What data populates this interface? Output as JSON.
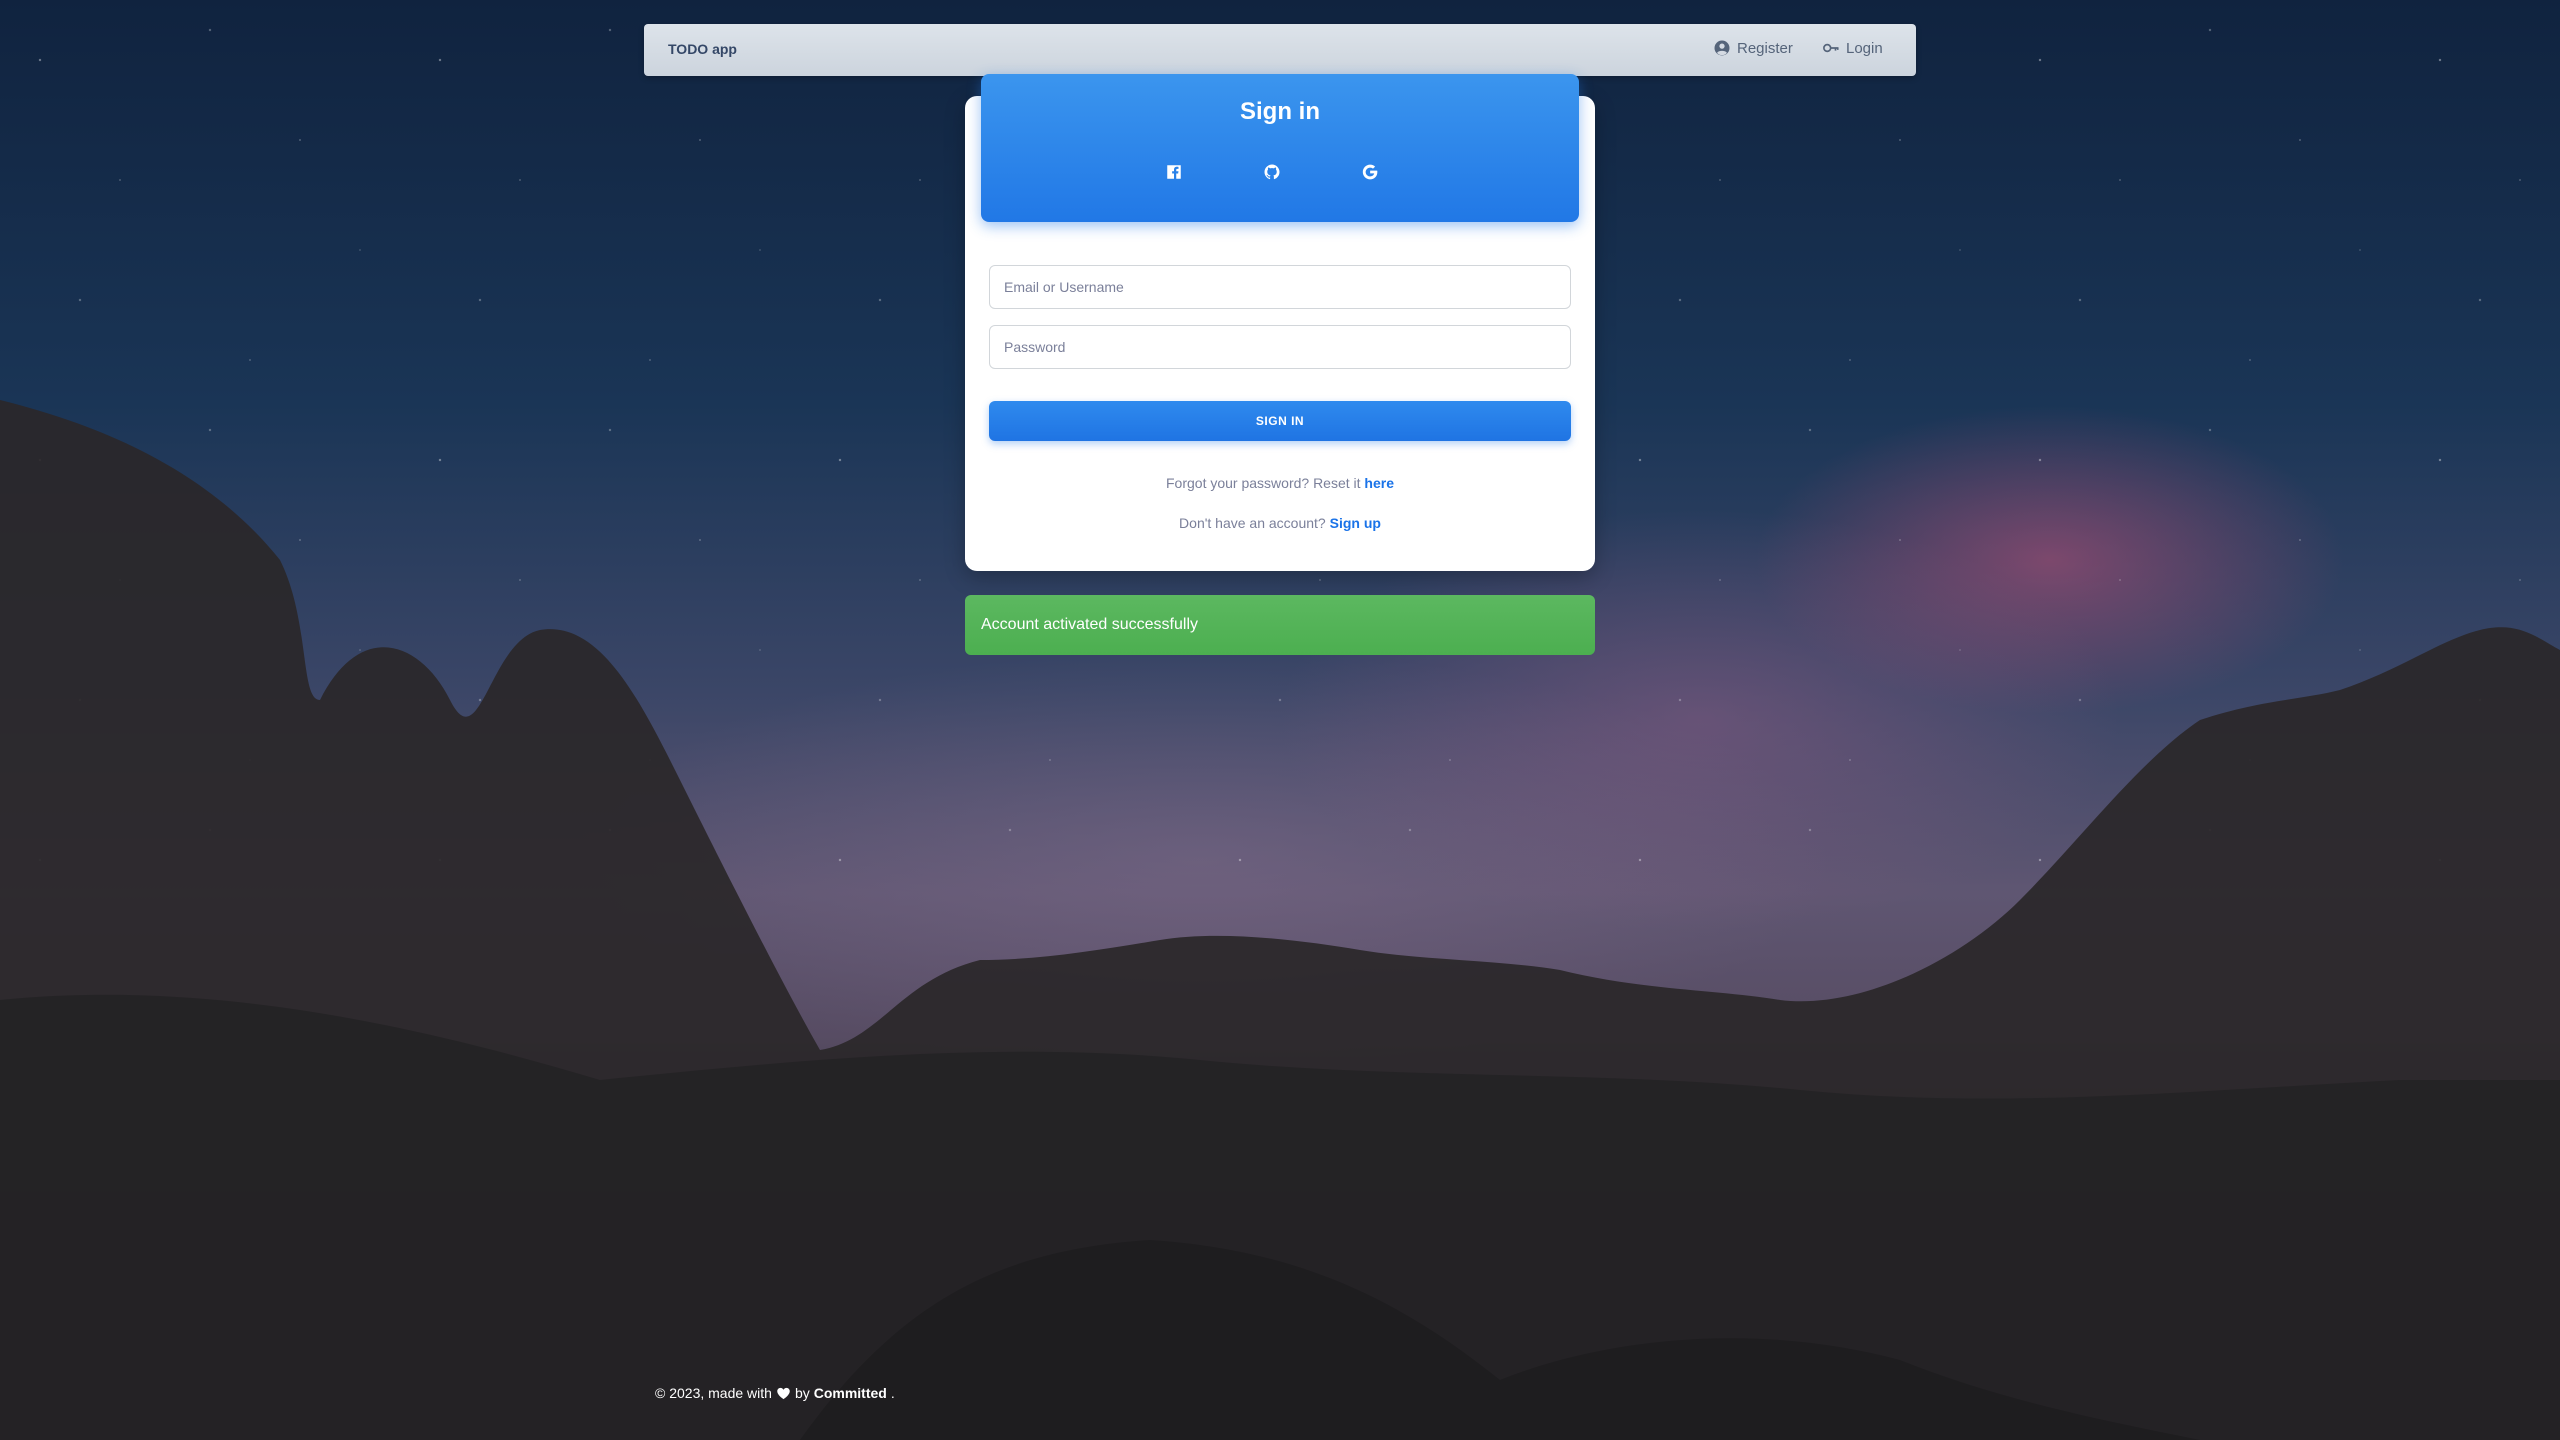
{
  "navbar": {
    "brand": "TODO app",
    "register_label": "Register",
    "login_label": "Login"
  },
  "signin_card": {
    "title": "Sign in",
    "social_icons": [
      "facebook-icon",
      "github-icon",
      "google-icon"
    ],
    "email_placeholder": "Email or Username",
    "password_placeholder": "Password",
    "submit_label": "SIGN IN",
    "forgot_text": "Forgot your password? Reset it ",
    "forgot_link": "here",
    "signup_text": "Don't have an account? ",
    "signup_link": "Sign up"
  },
  "alert": {
    "message": "Account activated successfully",
    "color": "#4caf50"
  },
  "footer": {
    "prefix": "© 2023, made with",
    "by": "by",
    "author": "Committed",
    "suffix": "."
  },
  "colors": {
    "primary": "#1a73e8",
    "success": "#4caf50"
  }
}
